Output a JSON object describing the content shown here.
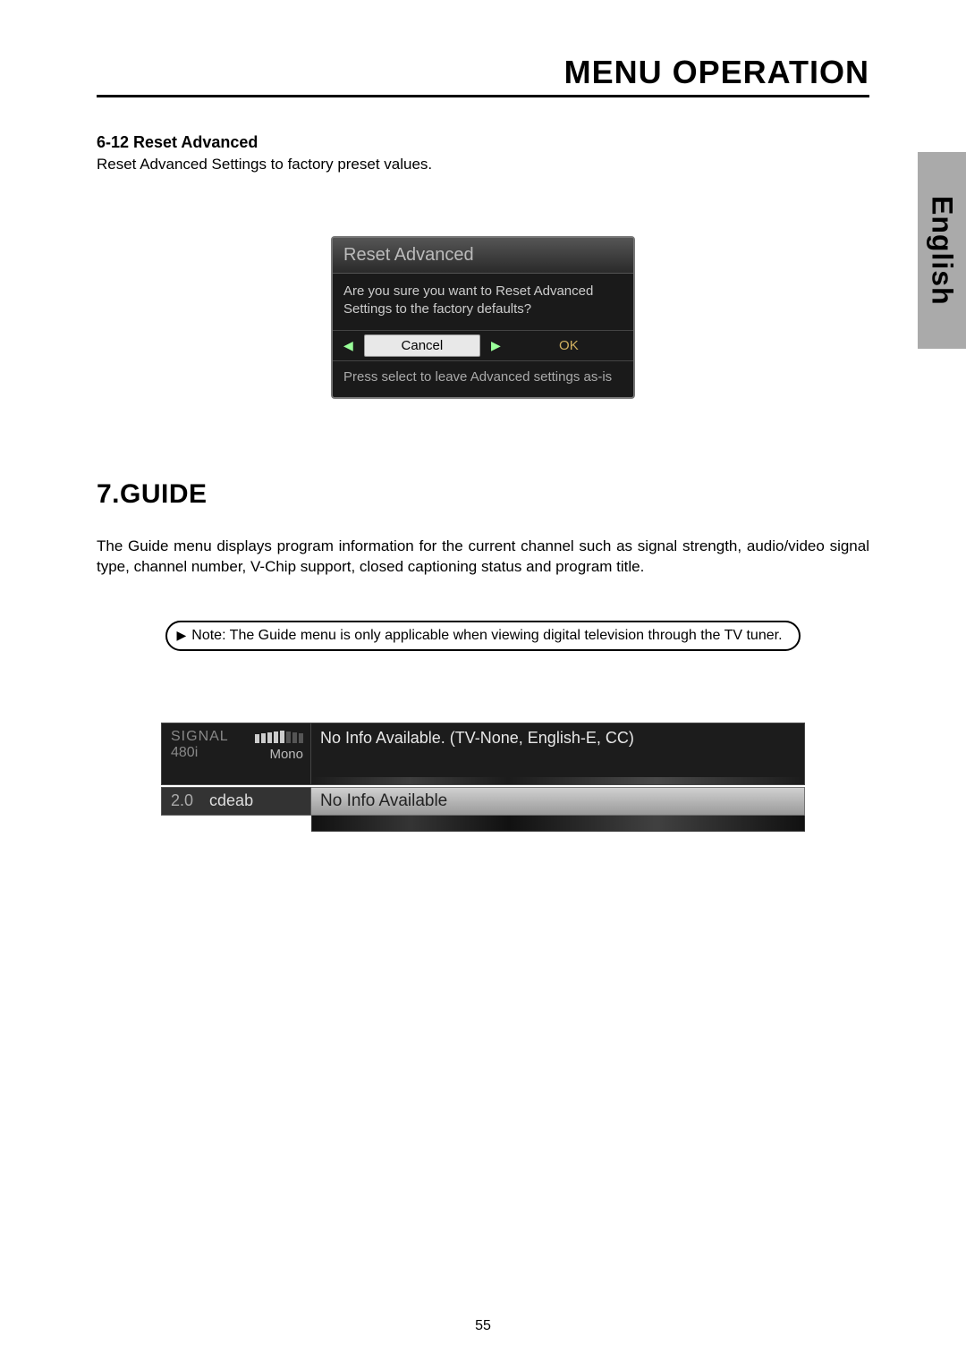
{
  "header": {
    "title": "MENU OPERATION"
  },
  "lang_tab": "English",
  "reset": {
    "heading": "6-12  Reset Advanced",
    "desc": "Reset Advanced Settings to factory preset values.",
    "dialog": {
      "title": "Reset Advanced",
      "message": "Are you sure you want to Reset Advanced Settings to the factory defaults?",
      "cancel": "Cancel",
      "ok": "OK",
      "hint": "Press select to leave Advanced settings as-is"
    }
  },
  "guide": {
    "heading": "7.GUIDE",
    "para": "The Guide menu displays program information for the current channel such as signal strength, audio/video signal type, channel number, V-Chip support, closed captioning status and program title.",
    "note": "Note: The Guide menu is only applicable when viewing digital television through the TV tuner.",
    "panel": {
      "signal_label": "SIGNAL",
      "video_mode": "480i",
      "audio_mode": "Mono",
      "signal_bars": {
        "on": 5,
        "total": 8
      },
      "info_top": "No Info Available. (TV-None, English-E, CC)",
      "channel": "2.0",
      "channel_name": "cdeab",
      "info_bot": "No Info Available"
    }
  },
  "page_number": "55"
}
